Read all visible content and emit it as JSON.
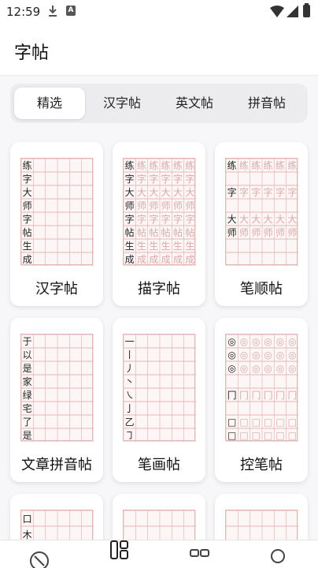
{
  "status_bar": {
    "time": "12:59",
    "badge": "A",
    "icons": [
      "download-icon",
      "a-badge-icon",
      "wifi-icon",
      "signal-icon",
      "battery-icon"
    ]
  },
  "app_bar": {
    "title": "字帖"
  },
  "tabs": [
    {
      "label": "精选",
      "active": true
    },
    {
      "label": "汉字帖",
      "active": false
    },
    {
      "label": "英文帖",
      "active": false
    },
    {
      "label": "拼音帖",
      "active": false
    }
  ],
  "cards": [
    {
      "label": "汉字帖",
      "chars": [
        "练",
        "字",
        "大",
        "师",
        "字",
        "帖",
        "生",
        "成"
      ]
    },
    {
      "label": "描字帖",
      "chars": [
        "练",
        "字",
        "大",
        "师",
        "字",
        "帖",
        "生",
        "成"
      ]
    },
    {
      "label": "笔顺帖",
      "chars": [
        "练",
        "",
        "字",
        "",
        "大",
        "师",
        "",
        ""
      ]
    },
    {
      "label": "文章拼音帖",
      "chars": [
        "于",
        "以",
        "是",
        "家",
        "绿",
        "宅",
        "了",
        "是"
      ]
    },
    {
      "label": "笔画帖",
      "chars": [
        "一",
        "丨",
        "丿",
        "丶",
        "㇏",
        "亅",
        "乙",
        "㇆"
      ]
    },
    {
      "label": "控笔帖",
      "chars": [
        "◎",
        "◎",
        "◎",
        "",
        "冂",
        "",
        "□",
        "□"
      ]
    },
    {
      "label": "",
      "chars": [
        "口",
        "木"
      ]
    },
    {
      "label": "",
      "chars": []
    },
    {
      "label": "",
      "chars": []
    }
  ],
  "bottom_nav": {
    "items": [
      "compass-icon",
      "grid-icon",
      "cards-icon",
      "search-icon"
    ]
  },
  "colors": {
    "grid_red": "#e6b5b5",
    "background": "#f7f7f9",
    "tab_track": "#ececef"
  }
}
